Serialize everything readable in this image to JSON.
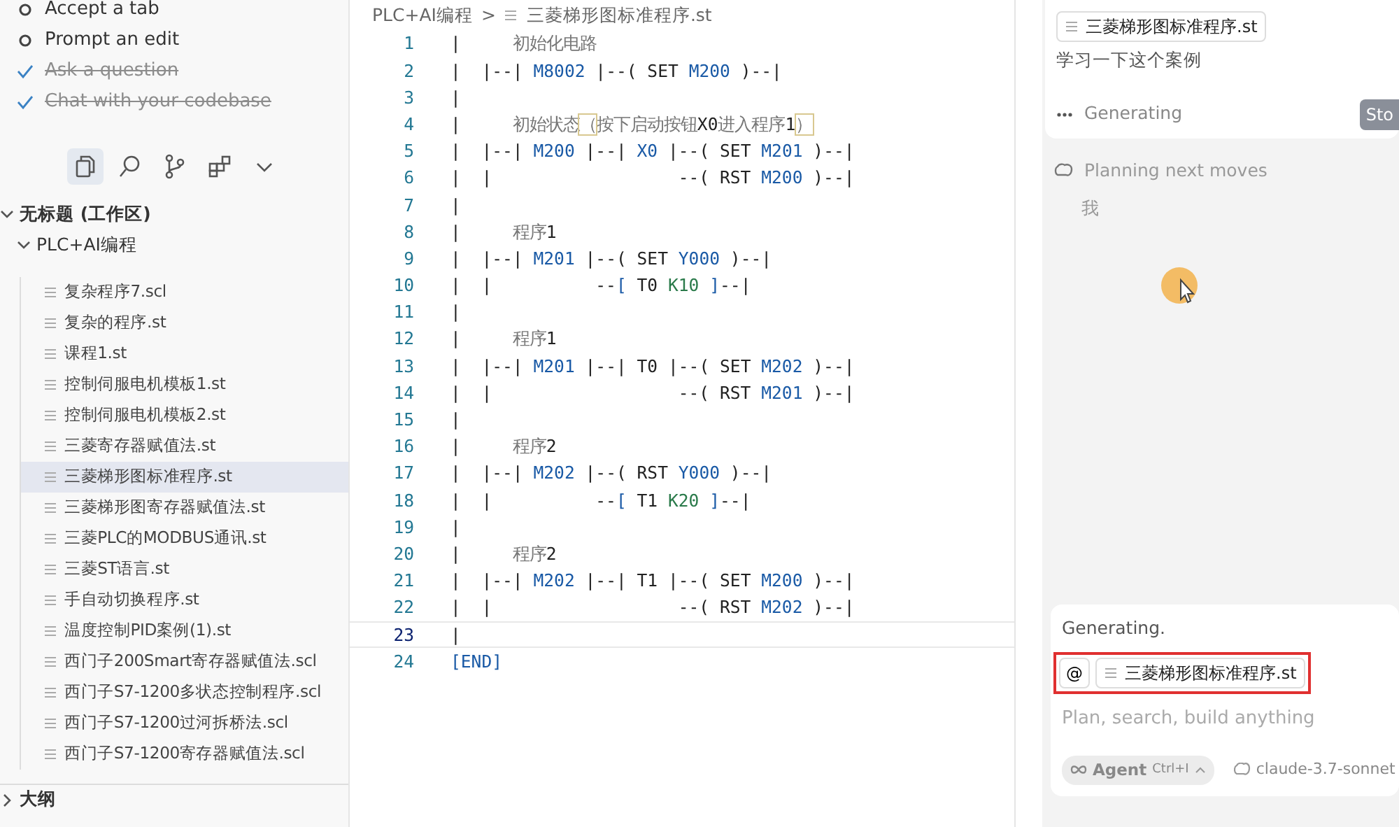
{
  "checklist": [
    {
      "label": "Accept a tab",
      "done": false
    },
    {
      "label": "Prompt an edit",
      "done": false
    },
    {
      "label": "Ask a question",
      "done": true
    },
    {
      "label": "Chat with your codebase",
      "done": true
    }
  ],
  "activity_bar": [
    {
      "kind": "files",
      "selected": true
    },
    {
      "kind": "search",
      "selected": false
    },
    {
      "kind": "source-control",
      "selected": false
    },
    {
      "kind": "extensions",
      "selected": false
    },
    {
      "kind": "more",
      "selected": false
    }
  ],
  "explorer": {
    "workspace": {
      "label": "无标题 (工作区)",
      "expanded": true
    },
    "folder": {
      "label": "PLC+AI编程",
      "expanded": true,
      "children": [
        {
          "label": "复杂程序7.scl",
          "selected": false
        },
        {
          "label": "复杂的程序.st",
          "selected": false
        },
        {
          "label": "课程1.st",
          "selected": false
        },
        {
          "label": "控制伺服电机模板1.st",
          "selected": false
        },
        {
          "label": "控制伺服电机模板2.st",
          "selected": false
        },
        {
          "label": "三菱寄存器赋值法.st",
          "selected": false
        },
        {
          "label": "三菱梯形图标准程序.st",
          "selected": true
        },
        {
          "label": "三菱梯形图寄存器赋值法.st",
          "selected": false
        },
        {
          "label": "三菱PLC的MODBUS通讯.st",
          "selected": false
        },
        {
          "label": "三菱ST语言.st",
          "selected": false
        },
        {
          "label": "手自动切换程序.st",
          "selected": false
        },
        {
          "label": "温度控制PID案例(1).st",
          "selected": false
        },
        {
          "label": "西门子200Smart寄存器赋值法.scl",
          "selected": false
        },
        {
          "label": "西门子S7-1200多状态控制程序.scl",
          "selected": false
        },
        {
          "label": "西门子S7-1200过河拆桥法.scl",
          "selected": false
        },
        {
          "label": "西门子S7-1200寄存器赋值法.scl",
          "selected": false
        }
      ]
    },
    "outline": {
      "label": "大纲",
      "expanded": false
    }
  },
  "breadcrumb": {
    "folder": "PLC+AI编程",
    "separator": ">",
    "file": "三菱梯形图标准程序.st"
  },
  "code": [
    {
      "n": "1",
      "current": false,
      "tokens": [
        {
          "text": "|     ",
          "kind": "plain"
        },
        {
          "text": "初始化电路",
          "kind": "cmt"
        }
      ]
    },
    {
      "n": "2",
      "current": false,
      "tokens": [
        {
          "text": "|  |--| ",
          "kind": "plain"
        },
        {
          "text": "M8002",
          "kind": "id"
        },
        {
          "text": " |--( SET ",
          "kind": "plain"
        },
        {
          "text": "M200",
          "kind": "id"
        },
        {
          "text": " )--|",
          "kind": "plain"
        }
      ]
    },
    {
      "n": "3",
      "current": false,
      "tokens": [
        {
          "text": "|",
          "kind": "plain"
        }
      ]
    },
    {
      "n": "4",
      "current": false,
      "tokens": [
        {
          "text": "|     ",
          "kind": "plain"
        },
        {
          "text": "初始状态",
          "kind": "cmt"
        },
        {
          "text": "（",
          "kind": "hl"
        },
        {
          "text": "按下启动按钮",
          "kind": "cmt"
        },
        {
          "text": "X0",
          "kind": "plain"
        },
        {
          "text": "进入程序",
          "kind": "cmt"
        },
        {
          "text": "1",
          "kind": "plain"
        },
        {
          "text": "）",
          "kind": "hl"
        }
      ]
    },
    {
      "n": "5",
      "current": false,
      "tokens": [
        {
          "text": "|  |--| ",
          "kind": "plain"
        },
        {
          "text": "M200",
          "kind": "id"
        },
        {
          "text": " |--| ",
          "kind": "plain"
        },
        {
          "text": "X0",
          "kind": "id"
        },
        {
          "text": " |--( SET ",
          "kind": "plain"
        },
        {
          "text": "M201",
          "kind": "id"
        },
        {
          "text": " )--|",
          "kind": "plain"
        }
      ]
    },
    {
      "n": "6",
      "current": false,
      "tokens": [
        {
          "text": "|  |                  --( RST ",
          "kind": "plain"
        },
        {
          "text": "M200",
          "kind": "id"
        },
        {
          "text": " )--|",
          "kind": "plain"
        }
      ]
    },
    {
      "n": "7",
      "current": false,
      "tokens": [
        {
          "text": "|",
          "kind": "plain"
        }
      ]
    },
    {
      "n": "8",
      "current": false,
      "tokens": [
        {
          "text": "|     ",
          "kind": "plain"
        },
        {
          "text": "程序",
          "kind": "cmt"
        },
        {
          "text": "1",
          "kind": "plain"
        }
      ]
    },
    {
      "n": "9",
      "current": false,
      "tokens": [
        {
          "text": "|  |--| ",
          "kind": "plain"
        },
        {
          "text": "M201",
          "kind": "id"
        },
        {
          "text": " |--( SET ",
          "kind": "plain"
        },
        {
          "text": "Y000",
          "kind": "id"
        },
        {
          "text": " )--|",
          "kind": "plain"
        }
      ]
    },
    {
      "n": "10",
      "current": false,
      "tokens": [
        {
          "text": "|  |          --",
          "kind": "plain"
        },
        {
          "text": "[",
          "kind": "id"
        },
        {
          "text": " T0 ",
          "kind": "plain"
        },
        {
          "text": "K10",
          "kind": "num"
        },
        {
          "text": " ]",
          "kind": "id"
        },
        {
          "text": "--|",
          "kind": "plain"
        }
      ]
    },
    {
      "n": "11",
      "current": false,
      "tokens": [
        {
          "text": "|",
          "kind": "plain"
        }
      ]
    },
    {
      "n": "12",
      "current": false,
      "tokens": [
        {
          "text": "|     ",
          "kind": "plain"
        },
        {
          "text": "程序",
          "kind": "cmt"
        },
        {
          "text": "1",
          "kind": "plain"
        }
      ]
    },
    {
      "n": "13",
      "current": false,
      "tokens": [
        {
          "text": "|  |--| ",
          "kind": "plain"
        },
        {
          "text": "M201",
          "kind": "id"
        },
        {
          "text": " |--| T0 |--( SET ",
          "kind": "plain"
        },
        {
          "text": "M202",
          "kind": "id"
        },
        {
          "text": " )--|",
          "kind": "plain"
        }
      ]
    },
    {
      "n": "14",
      "current": false,
      "tokens": [
        {
          "text": "|  |                  --( RST ",
          "kind": "plain"
        },
        {
          "text": "M201",
          "kind": "id"
        },
        {
          "text": " )--|",
          "kind": "plain"
        }
      ]
    },
    {
      "n": "15",
      "current": false,
      "tokens": [
        {
          "text": "|",
          "kind": "plain"
        }
      ]
    },
    {
      "n": "16",
      "current": false,
      "tokens": [
        {
          "text": "|     ",
          "kind": "plain"
        },
        {
          "text": "程序",
          "kind": "cmt"
        },
        {
          "text": "2",
          "kind": "plain"
        }
      ]
    },
    {
      "n": "17",
      "current": false,
      "tokens": [
        {
          "text": "|  |--| ",
          "kind": "plain"
        },
        {
          "text": "M202",
          "kind": "id"
        },
        {
          "text": " |--( RST ",
          "kind": "plain"
        },
        {
          "text": "Y000",
          "kind": "id"
        },
        {
          "text": " )--|",
          "kind": "plain"
        }
      ]
    },
    {
      "n": "18",
      "current": false,
      "tokens": [
        {
          "text": "|  |          --",
          "kind": "plain"
        },
        {
          "text": "[",
          "kind": "id"
        },
        {
          "text": " T1 ",
          "kind": "plain"
        },
        {
          "text": "K20",
          "kind": "num"
        },
        {
          "text": " ]",
          "kind": "id"
        },
        {
          "text": "--|",
          "kind": "plain"
        }
      ]
    },
    {
      "n": "19",
      "current": false,
      "tokens": [
        {
          "text": "|",
          "kind": "plain"
        }
      ]
    },
    {
      "n": "20",
      "current": false,
      "tokens": [
        {
          "text": "|     ",
          "kind": "plain"
        },
        {
          "text": "程序",
          "kind": "cmt"
        },
        {
          "text": "2",
          "kind": "plain"
        }
      ]
    },
    {
      "n": "21",
      "current": false,
      "tokens": [
        {
          "text": "|  |--| ",
          "kind": "plain"
        },
        {
          "text": "M202",
          "kind": "id"
        },
        {
          "text": " |--| T1 |--( SET ",
          "kind": "plain"
        },
        {
          "text": "M200",
          "kind": "id"
        },
        {
          "text": " )--|",
          "kind": "plain"
        }
      ]
    },
    {
      "n": "22",
      "current": false,
      "tokens": [
        {
          "text": "|  |                  --( RST ",
          "kind": "plain"
        },
        {
          "text": "M202",
          "kind": "id"
        },
        {
          "text": " )--|",
          "kind": "plain"
        }
      ]
    },
    {
      "n": "23",
      "current": true,
      "tokens": [
        {
          "text": "|",
          "kind": "plain"
        }
      ]
    },
    {
      "n": "24",
      "current": false,
      "tokens": [
        {
          "text": "[END]",
          "kind": "id"
        }
      ]
    }
  ],
  "chat": {
    "message": {
      "file_chip": "三菱梯形图标准程序.st",
      "text": "学习一下这个案例",
      "status": "Generating",
      "stop_button": "Sto"
    },
    "planning": {
      "label": "Planning next moves",
      "text": "我"
    },
    "composer": {
      "status": "Generating.",
      "mention_button": "@",
      "file_chip": "三菱梯形图标准程序.st",
      "placeholder": "Plan, search, build anything",
      "mode": {
        "label": "Agent",
        "shortcut": "Ctrl+I"
      },
      "model": "claude-3.7-sonnet"
    }
  }
}
